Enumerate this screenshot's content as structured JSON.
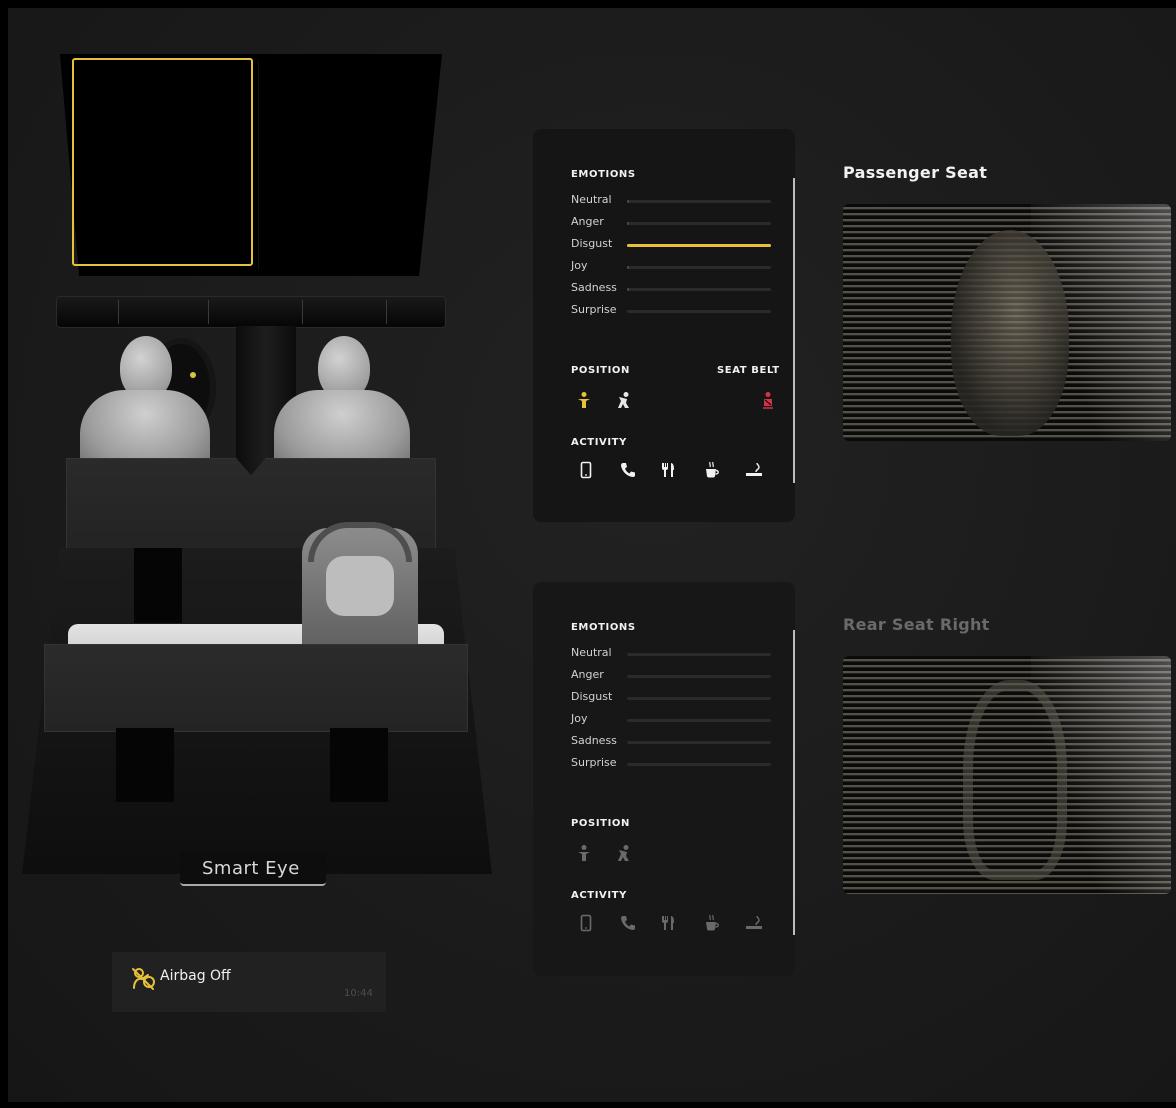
{
  "brand": {
    "label": "Smart Eye"
  },
  "notification": {
    "icon": "airbag-off-icon",
    "label": "Airbag Off",
    "time": "10:44"
  },
  "colors": {
    "accent": "#e6c23a",
    "alert": "#d6314a",
    "muted": "#6a6a6a"
  },
  "passenger_panel": {
    "emotions_title": "EMOTIONS",
    "emotions": [
      {
        "label": "Neutral",
        "level": 0.01
      },
      {
        "label": "Anger",
        "level": 0.01
      },
      {
        "label": "Disgust",
        "level": 1.0
      },
      {
        "label": "Joy",
        "level": 0.01
      },
      {
        "label": "Sadness",
        "level": 0.01
      },
      {
        "label": "Surprise",
        "level": 0.0
      }
    ],
    "position_title": "POSITION",
    "seatbelt_title": "SEAT BELT",
    "position_icons": [
      "person-upright-icon",
      "person-leaning-icon"
    ],
    "seatbelt_icon": "seatbelt-unbuckled-icon",
    "activity_title": "ACTIVITY",
    "activity_icons": [
      "phone-icon",
      "call-icon",
      "eating-icon",
      "drinking-icon",
      "smoking-icon"
    ]
  },
  "rear_panel": {
    "emotions_title": "EMOTIONS",
    "emotions": [
      {
        "label": "Neutral",
        "level": 0.0
      },
      {
        "label": "Anger",
        "level": 0.0
      },
      {
        "label": "Disgust",
        "level": 0.0
      },
      {
        "label": "Joy",
        "level": 0.0
      },
      {
        "label": "Sadness",
        "level": 0.0
      },
      {
        "label": "Surprise",
        "level": 0.0
      }
    ],
    "position_title": "POSITION",
    "position_icons": [
      "person-upright-icon",
      "person-leaning-icon"
    ],
    "activity_title": "ACTIVITY",
    "activity_icons": [
      "phone-icon",
      "call-icon",
      "eating-icon",
      "drinking-icon",
      "smoking-icon"
    ]
  },
  "cameras": {
    "passenger": {
      "title": "Passenger Seat"
    },
    "rear_right": {
      "title": "Rear Seat Right"
    }
  }
}
